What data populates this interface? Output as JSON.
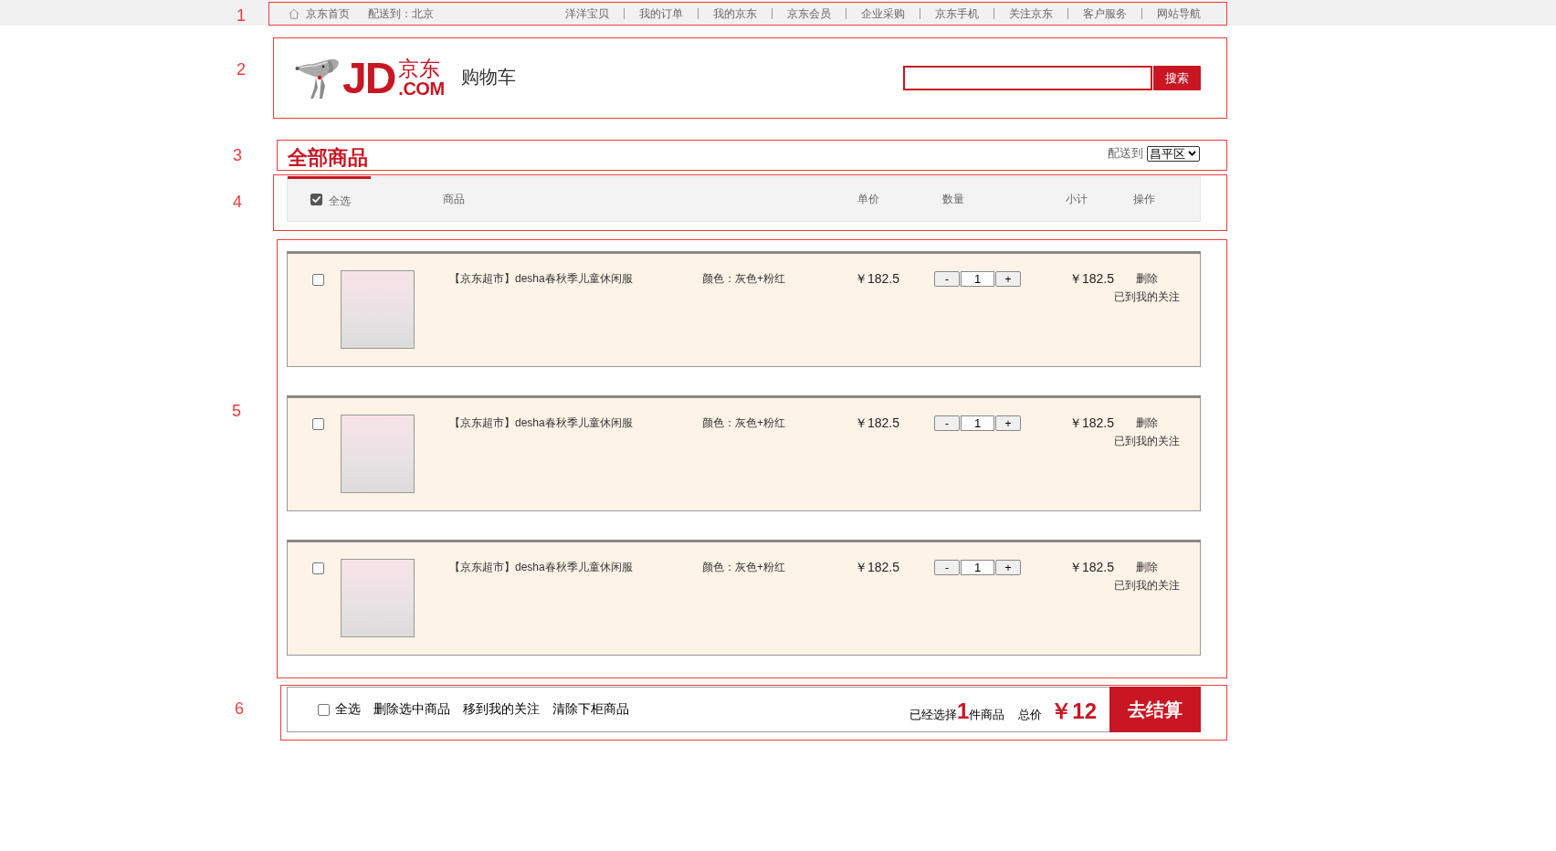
{
  "top_bar": {
    "annotation": "1",
    "home_link": "京东首页",
    "delivery": "配送到：北京",
    "links": [
      "洋洋宝贝",
      "我的订单",
      "我的京东",
      "京东会员",
      "企业采购",
      "京东手机",
      "关注京东",
      "客户服务",
      "网站导航"
    ]
  },
  "header": {
    "annotation": "2",
    "logo": {
      "letters": "JD",
      "chinese": "京东",
      "domain": ".COM"
    },
    "page_title": "购物车",
    "search_button": "搜索"
  },
  "section_title": {
    "annotation": "3",
    "title": "全部商品",
    "delivery_label": "配送到",
    "region": "昌平区"
  },
  "table_header": {
    "annotation": "4",
    "select_all": {
      "label": "全选",
      "checked": true
    },
    "columns": [
      "商品",
      "单价",
      "数量",
      "小计",
      "操作"
    ]
  },
  "cart": {
    "annotation": "5",
    "items": [
      {
        "checked": false,
        "title": "【京东超市】desha春秋季儿童休闲服",
        "attributes": "颜色：灰色+粉红",
        "price": "￥182.5",
        "decrement": "-",
        "quantity": "1",
        "increment": "+",
        "subtotal": "￥182.5",
        "actions": [
          "删除",
          "已到我的关注"
        ]
      },
      {
        "checked": false,
        "title": "【京东超市】desha春秋季儿童休闲服",
        "attributes": "颜色：灰色+粉红",
        "price": "￥182.5",
        "decrement": "-",
        "quantity": "1",
        "increment": "+",
        "subtotal": "￥182.5",
        "actions": [
          "删除",
          "已到我的关注"
        ]
      },
      {
        "checked": false,
        "title": "【京东超市】desha春秋季儿童休闲服",
        "attributes": "颜色：灰色+粉红",
        "price": "￥182.5",
        "decrement": "-",
        "quantity": "1",
        "increment": "+",
        "subtotal": "￥182.5",
        "actions": [
          "删除",
          "已到我的关注"
        ]
      }
    ]
  },
  "footer": {
    "annotation": "6",
    "select_all": {
      "label": "全选",
      "checked": false
    },
    "actions": [
      "删除选中商品",
      "移到我的关注",
      "清除下柜商品"
    ],
    "summary": "已经选择**1**件商品",
    "total_label": "总价",
    "total": "￥12",
    "checkout_button": "去结算"
  }
}
